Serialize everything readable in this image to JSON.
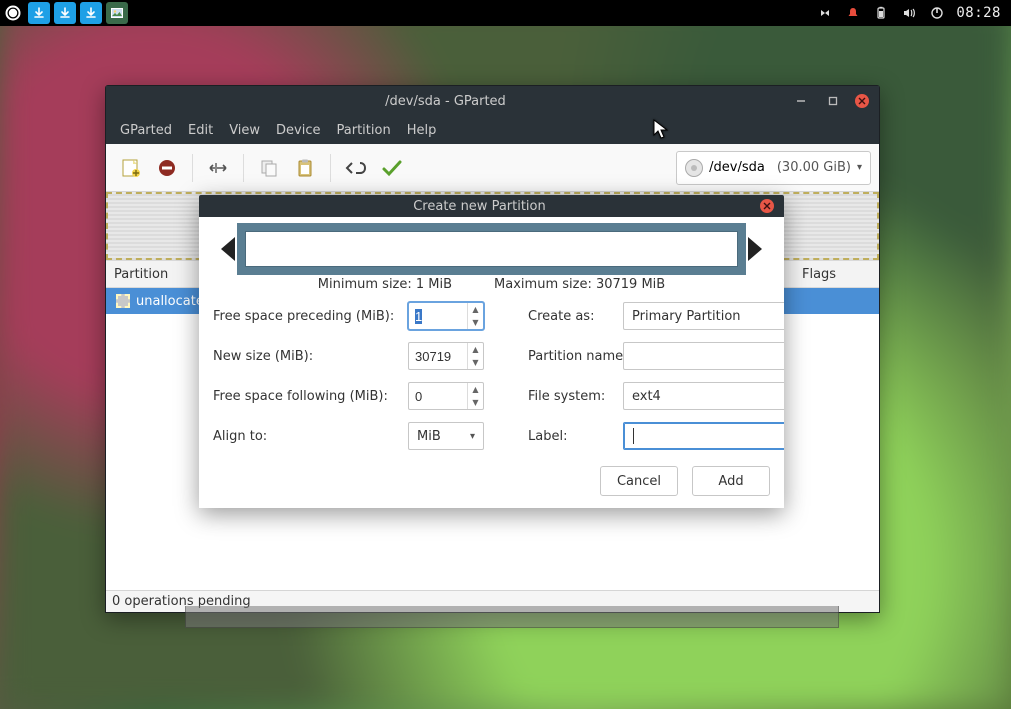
{
  "panel": {
    "clock": "08:28",
    "tasks": [
      "download-1",
      "download-2",
      "download-3",
      "image-viewer"
    ]
  },
  "window": {
    "title": "/dev/sda - GParted",
    "menus": [
      "GParted",
      "Edit",
      "View",
      "Device",
      "Partition",
      "Help"
    ],
    "device_combo": {
      "device": "/dev/sda",
      "size": "(30.00 GiB)"
    },
    "columns": {
      "partition": "Partition",
      "flags": "Flags"
    },
    "rows": [
      {
        "label": "unallocated"
      }
    ],
    "status": "0 operations pending"
  },
  "dialog": {
    "title": "Create new Partition",
    "min_label": "Minimum size: 1 MiB",
    "max_label": "Maximum size: 30719 MiB",
    "labels": {
      "free_pre": "Free space preceding (MiB):",
      "new_size": "New size (MiB):",
      "free_post": "Free space following (MiB):",
      "align": "Align to:",
      "create_as": "Create as:",
      "part_name": "Partition name:",
      "fs": "File system:",
      "label": "Label:"
    },
    "values": {
      "free_pre": "1",
      "new_size": "30719",
      "free_post": "0",
      "align": "MiB",
      "create_as": "Primary Partition",
      "part_name": "",
      "fs": "ext4",
      "label": ""
    },
    "buttons": {
      "cancel": "Cancel",
      "add": "Add"
    }
  }
}
